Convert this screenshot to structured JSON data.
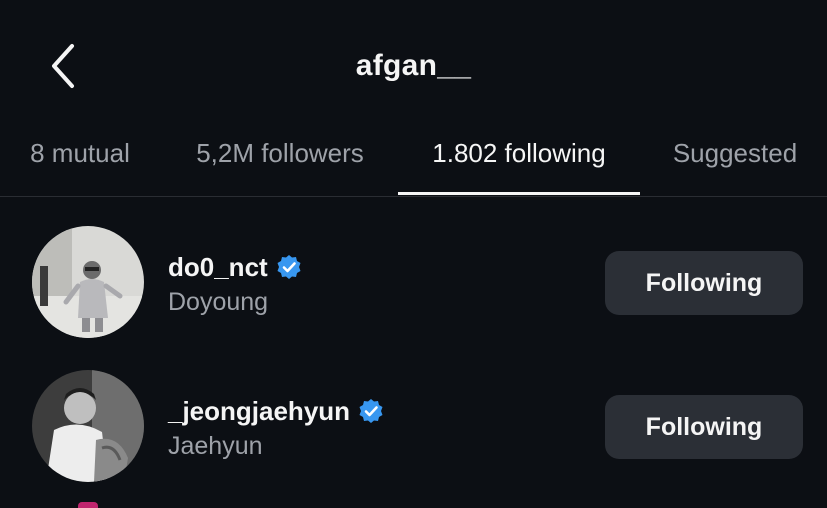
{
  "header": {
    "title": "afgan__",
    "back_icon": "chevron-left-icon"
  },
  "tabs": [
    {
      "label": "8 mutual",
      "active": false
    },
    {
      "label": "5,2M followers",
      "active": false
    },
    {
      "label": "1.802 following",
      "active": true
    },
    {
      "label": "Suggested",
      "active": false
    }
  ],
  "users": [
    {
      "username": "do0_nct",
      "display_name": "Doyoung",
      "verified": true,
      "button_label": "Following"
    },
    {
      "username": "_jeongjaehyun",
      "display_name": "Jaehyun",
      "verified": true,
      "button_label": "Following"
    }
  ],
  "colors": {
    "background": "#0c0f14",
    "button_bg": "#2b2f36",
    "verified": "#3897f0",
    "muted_text": "#9ea2a9"
  }
}
